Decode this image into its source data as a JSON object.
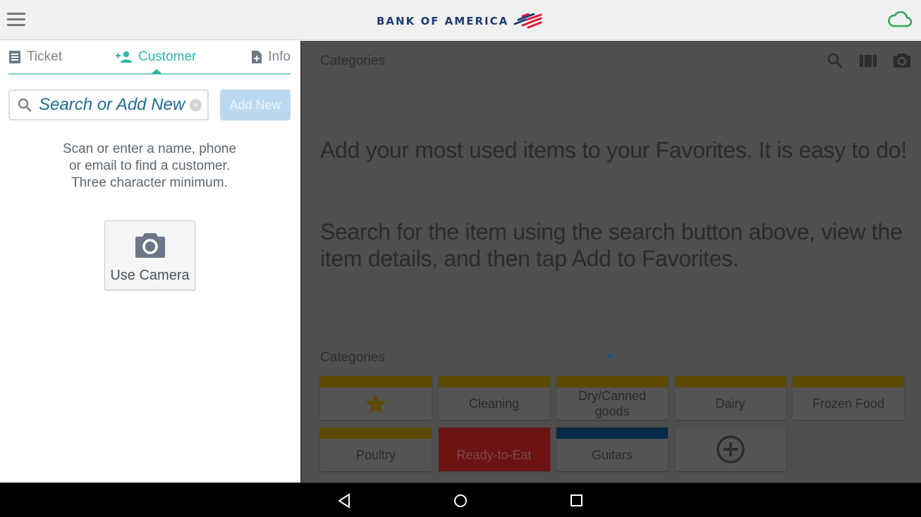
{
  "header": {
    "brand": "BANK OF AMERICA",
    "colors": {
      "brand_blue": "#1f3b73",
      "brand_red": "#e31837",
      "sync_green": "#2eaa5c"
    }
  },
  "left_panel": {
    "tabs": [
      {
        "label": "Ticket",
        "icon": "receipt-icon",
        "active": false
      },
      {
        "label": "Customer",
        "icon": "add-person-icon",
        "active": true
      },
      {
        "label": "Info",
        "icon": "add-document-icon",
        "active": false
      }
    ],
    "search": {
      "placeholder": "Search or Add New",
      "value": ""
    },
    "add_new_label": "Add New",
    "hint_lines": [
      "Scan or enter a name, phone",
      "or email to find a customer.",
      "Three character minimum."
    ],
    "camera_button_label": "Use Camera",
    "accent_color": "#2bb7a8"
  },
  "right_panel": {
    "title": "Categories",
    "toolbar_icons": [
      "search-icon",
      "barcode-icon",
      "camera-icon"
    ],
    "message_1": "Add your most used items to your Favorites. It is easy to do!",
    "message_2": "Search for the item using the search button above, view the item details, and then tap Add to Favorites.",
    "categories_title": "Categories",
    "categories": [
      {
        "label": "",
        "icon": "star-icon",
        "bar_color": "#5c4a00"
      },
      {
        "label": "Cleaning",
        "bar_color": "#5c4a00"
      },
      {
        "label": "Dry/Canned goods",
        "bar_color": "#5c4a00"
      },
      {
        "label": "Dairy",
        "bar_color": "#5c4a00"
      },
      {
        "label": "Frozen Food",
        "bar_color": "#5c4a00"
      },
      {
        "label": "Poultry",
        "bar_color": "#5c4a00"
      },
      {
        "label": "Ready-to-Eat",
        "bar_color": "#6e1313",
        "filled": true
      },
      {
        "label": "Guitars",
        "bar_color": "#022a44"
      },
      {
        "label": "",
        "icon": "add-circle-icon",
        "bar_color": null
      }
    ]
  },
  "nav_bar": {
    "buttons": [
      "back",
      "home",
      "recents"
    ]
  }
}
